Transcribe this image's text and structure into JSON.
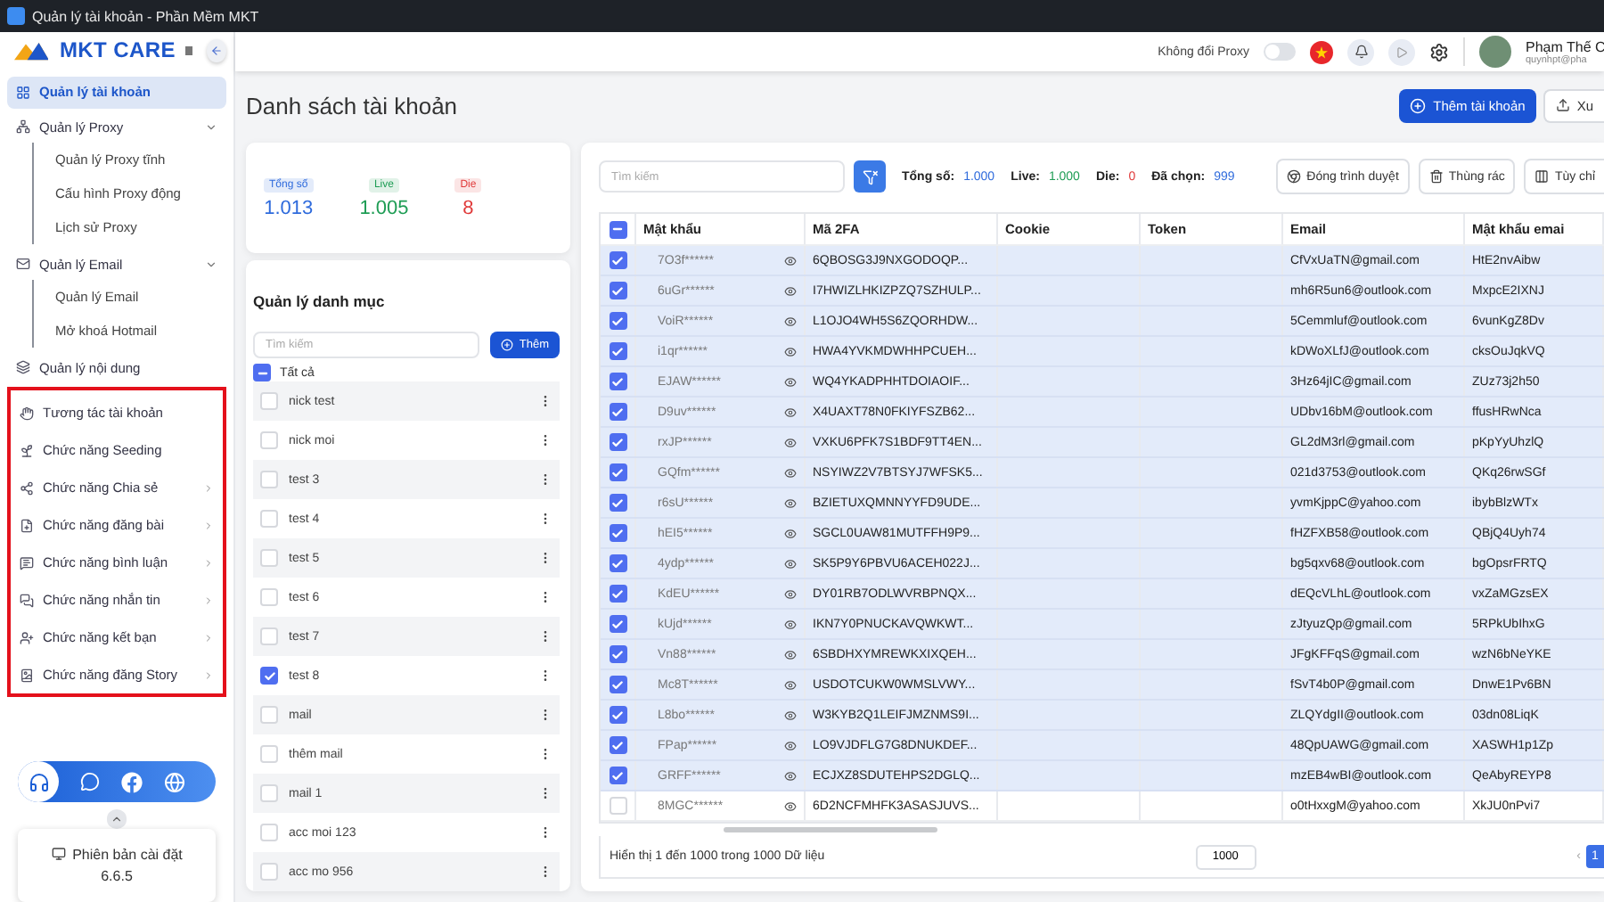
{
  "window": {
    "title": "Quản lý tài khoản - Phần Mềm MKT"
  },
  "sidebar": {
    "logo": "MKT CARE",
    "items": [
      {
        "label": "Quản lý tài khoản",
        "selected": true
      },
      {
        "label": "Quản lý Proxy",
        "selected": false,
        "expanded": true,
        "children": [
          {
            "label": "Quản lý Proxy tĩnh",
            "selected": false
          },
          {
            "label": "Cấu hình Proxy động",
            "selected": false
          },
          {
            "label": "Lịch sử Proxy",
            "selected": false
          }
        ]
      },
      {
        "label": "Quản lý Email",
        "selected": false,
        "expanded": true,
        "children": [
          {
            "label": "Quản lý Email",
            "selected": false
          },
          {
            "label": "Mở khoá Hotmail",
            "selected": false
          }
        ]
      },
      {
        "label": "Quản lý nội dung",
        "selected": false
      }
    ],
    "feature_group": {
      "highlighted": true,
      "items": [
        {
          "label": "Tương tác tài khoản",
          "selected": false,
          "has_submenu": false
        },
        {
          "label": "Chức năng Seeding",
          "selected": false,
          "has_submenu": false
        },
        {
          "label": "Chức năng Chia sẻ",
          "selected": false,
          "has_submenu": true
        },
        {
          "label": "Chức năng đăng bài",
          "selected": false,
          "has_submenu": true
        },
        {
          "label": "Chức năng bình luận",
          "selected": false,
          "has_submenu": true
        },
        {
          "label": "Chức năng nhắn tin",
          "selected": false,
          "has_submenu": true
        },
        {
          "label": "Chức năng kết bạn",
          "selected": false,
          "has_submenu": true
        },
        {
          "label": "Chức năng đăng Story",
          "selected": false,
          "has_submenu": true
        }
      ]
    },
    "version": {
      "label": "Phiên bản cài đặt",
      "value": "6.6.5"
    }
  },
  "header": {
    "proxy_toggle": {
      "label": "Không đổi Proxy",
      "on": false
    },
    "user": {
      "name": "Phạm Thế C",
      "email": "quynhpt@pha"
    }
  },
  "page": {
    "title": "Danh sách tài khoản",
    "buttons": [
      {
        "label": "Thêm tài khoản",
        "kind": "primary"
      },
      {
        "label": "Xu",
        "kind": "outline"
      }
    ]
  },
  "stats": [
    {
      "label": "Tổng số",
      "value": "1.013",
      "color": "#2f6bdc"
    },
    {
      "label": "Live",
      "value": "1.005",
      "color": "#1f9d55"
    },
    {
      "label": "Die",
      "value": "8",
      "color": "#e03a3a"
    }
  ],
  "categories": {
    "title": "Quản lý danh mục",
    "search": {
      "placeholder": "Tìm kiếm"
    },
    "add_button": "Thêm",
    "all": {
      "label": "Tất cả",
      "indeterminate": true
    },
    "items": [
      {
        "label": "nick test",
        "checked": false
      },
      {
        "label": "nick moi",
        "checked": false
      },
      {
        "label": "test 3",
        "checked": false
      },
      {
        "label": "test 4",
        "checked": false
      },
      {
        "label": "test 5",
        "checked": false
      },
      {
        "label": "test 6",
        "checked": false
      },
      {
        "label": "test 7",
        "checked": false
      },
      {
        "label": "test 8",
        "checked": true
      },
      {
        "label": "mail",
        "checked": false
      },
      {
        "label": "thêm mail",
        "checked": false
      },
      {
        "label": "mail 1",
        "checked": false
      },
      {
        "label": "acc moi 123",
        "checked": false
      },
      {
        "label": "acc mo 956",
        "checked": false
      }
    ]
  },
  "accounts": {
    "search": {
      "placeholder": "Tìm kiếm"
    },
    "summary": [
      {
        "label": "Tổng số:",
        "value": "1.000",
        "color": "#2f6bdc"
      },
      {
        "label": "Live:",
        "value": "1.000",
        "color": "#1f9d55"
      },
      {
        "label": "Die:",
        "value": "0",
        "color": "#e03a3a"
      },
      {
        "label": "Đã chọn:",
        "value": "999",
        "color": "#2f6bdc"
      }
    ],
    "actions": [
      "Đóng trình duyệt",
      "Thùng rác",
      "Tùy chỉ"
    ],
    "table": {
      "select_all": {
        "indeterminate": true
      },
      "columns": [
        "Mật khẩu",
        "Mã 2FA",
        "Cookie",
        "Token",
        "Email",
        "Mật khẩu emai"
      ],
      "rows": [
        {
          "password": "7O3f******",
          "twofa": "6QBOSG3J9NXGODOQP...",
          "email": "CfVxUaTN@gmail.com",
          "email_password": "HtE2nvAibw",
          "selected": true
        },
        {
          "password": "6uGr******",
          "twofa": "I7HWIZLHKIZPZQ7SZHULP...",
          "email": "mh6R5un6@outlook.com",
          "email_password": "MxpcE2IXNJ",
          "selected": true
        },
        {
          "password": "VoiR******",
          "twofa": "L1OJO4WH5S6ZQORHDW...",
          "email": "5Cemmluf@outlook.com",
          "email_password": "6vunKgZ8Dv",
          "selected": true
        },
        {
          "password": "i1qr******",
          "twofa": "HWA4YVKMDWHHPCUEH...",
          "email": "kDWoXLfJ@outlook.com",
          "email_password": "cksOuJqkVQ",
          "selected": true
        },
        {
          "password": "EJAW******",
          "twofa": "WQ4YKADPHHTDOIAOIF...",
          "email": "3Hz64jIC@gmail.com",
          "email_password": "ZUz73j2h50",
          "selected": true
        },
        {
          "password": "D9uv******",
          "twofa": "X4UAXT78N0FKIYFSZB62...",
          "email": "UDbv16bM@outlook.com",
          "email_password": "ffusHRwNca",
          "selected": true
        },
        {
          "password": "rxJP******",
          "twofa": "VXKU6PFK7S1BDF9TT4EN...",
          "email": "GL2dM3rl@gmail.com",
          "email_password": "pKpYyUhzlQ",
          "selected": true
        },
        {
          "password": "GQfm******",
          "twofa": "NSYIWZ2V7BTSYJ7WFSK5...",
          "email": "021d3753@outlook.com",
          "email_password": "QKq26rwSGf",
          "selected": true
        },
        {
          "password": "r6sU******",
          "twofa": "BZIETUXQMNNYYFD9UDE...",
          "email": "yvmKjppC@yahoo.com",
          "email_password": "ibybBlzWTx",
          "selected": true
        },
        {
          "password": "hEI5******",
          "twofa": "SGCL0UAW81MUTFFH9P9...",
          "email": "fHZFXB58@outlook.com",
          "email_password": "QBjQ4Uyh74",
          "selected": true
        },
        {
          "password": "4ydp******",
          "twofa": "SK5P9Y6PBVU6ACEH022J...",
          "email": "bg5qxv68@outlook.com",
          "email_password": "bgOpsrFRTQ",
          "selected": true
        },
        {
          "password": "KdEU******",
          "twofa": "DY01RB7ODLWVRBPNQX...",
          "email": "dEQcVLhL@outlook.com",
          "email_password": "vxZaMGzsEX",
          "selected": true
        },
        {
          "password": "kUjd******",
          "twofa": "IKN7Y0PNUCKAVQWKWT...",
          "email": "zJtyuzQp@gmail.com",
          "email_password": "5RPkUbIhxG",
          "selected": true
        },
        {
          "password": "Vn88******",
          "twofa": "6SBDHXYMREWKXIXQEH...",
          "email": "JFgKFFqS@gmail.com",
          "email_password": "wzN6bNeYKE",
          "selected": true
        },
        {
          "password": "Mc8T******",
          "twofa": "USDOTCUKW0WMSLVWY...",
          "email": "fSvT4b0P@gmail.com",
          "email_password": "DnwE1Pv6BN",
          "selected": true
        },
        {
          "password": "L8bo******",
          "twofa": "W3KYB2Q1LEIFJMZNMS9I...",
          "email": "ZLQYdgII@outlook.com",
          "email_password": "03dn08LiqK",
          "selected": true
        },
        {
          "password": "FPap******",
          "twofa": "LO9VJDFLG7G8DNUKDEF...",
          "email": "48QpUAWG@gmail.com",
          "email_password": "XASWH1p1Zp",
          "selected": true
        },
        {
          "password": "GRFF******",
          "twofa": "ECJXZ8SDUTEHPS2DGLQ...",
          "email": "mzEB4wBI@outlook.com",
          "email_password": "QeAbyREYP8",
          "selected": true
        },
        {
          "password": "8MGC******",
          "twofa": "6D2NCFMHFK3ASASJUVS...",
          "email": "o0tHxxgM@yahoo.com",
          "email_password": "XkJU0nPvi7",
          "selected": false
        }
      ]
    },
    "footer": {
      "info": "Hiển thị 1 đến 1000 trong 1000 Dữ liệu",
      "page_size": "1000",
      "prev": "‹",
      "pages": [
        {
          "label": "1",
          "selected": true
        }
      ]
    }
  }
}
